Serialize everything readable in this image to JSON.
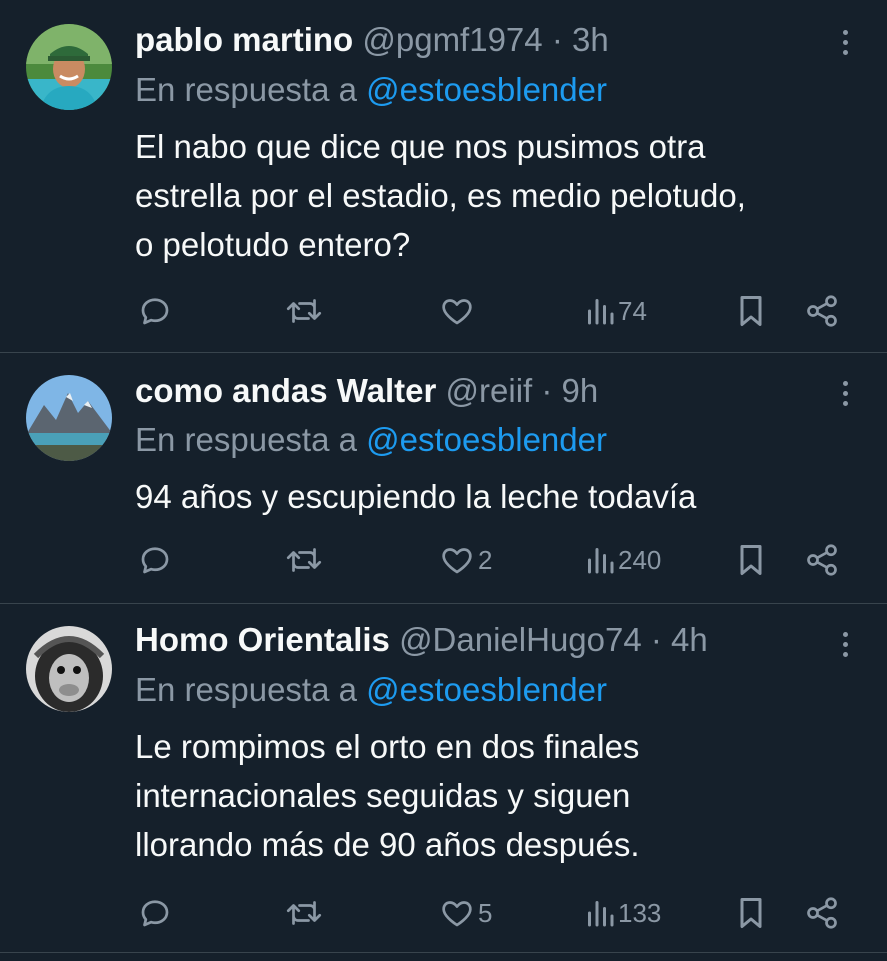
{
  "colors": {
    "background": "#15202b",
    "text": "#f7f9f9",
    "muted": "#8b98a5",
    "link": "#1d9bf0",
    "divider": "#38444d"
  },
  "tweets": [
    {
      "name": "pablo martino",
      "handle": "@pgmf1974",
      "time": "· 3h",
      "reply_prefix": "En respuesta a",
      "reply_handle": "@estoesblender",
      "lines": [
        "El nabo que dice que nos pusimos otra",
        "estrella por el estadio, es medio pelotudo,",
        "o pelotudo entero?"
      ],
      "likes": "",
      "views": "74"
    },
    {
      "name": "como andas Walter",
      "handle": "@reiif",
      "time": "· 9h",
      "reply_prefix": "En respuesta a",
      "reply_handle": "@estoesblender",
      "lines": [
        "94 años y escupiendo la leche todavía"
      ],
      "likes": "2",
      "views": "240"
    },
    {
      "name": "Homo Orientalis",
      "handle": "@DanielHugo74",
      "time": "· 4h",
      "reply_prefix": "En respuesta a",
      "reply_handle": "@estoesblender",
      "lines": [
        "Le rompimos el orto en dos finales",
        "internacionales seguidas y siguen",
        "llorando más de 90 años después."
      ],
      "likes": "5",
      "views": "133"
    }
  ],
  "icons": [
    "reply-icon",
    "retweet-icon",
    "like-icon",
    "views-icon",
    "bookmark-icon",
    "share-icon",
    "more-icon"
  ]
}
